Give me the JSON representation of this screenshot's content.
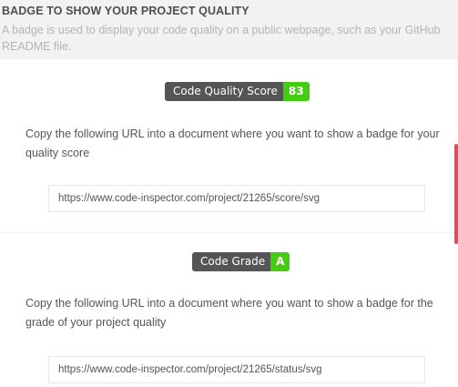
{
  "section": {
    "title": "BADGE TO SHOW YOUR PROJECT QUALITY",
    "description": "A badge is used to display your code quality on a public webpage, such as your GitHub README file."
  },
  "quality_badge": {
    "label": "Code Quality Score",
    "value": "83",
    "label_color": "#555555",
    "value_color": "#44cc11",
    "instruction": "Copy the following URL into a document where you want to show a badge for your quality score",
    "url": "https://www.code-inspector.com/project/21265/score/svg"
  },
  "grade_badge": {
    "label": "Code Grade",
    "value": "A",
    "label_color": "#555555",
    "value_color": "#44cc11",
    "instruction": "Copy the following URL into a document where you want to show a badge for the grade of your project quality",
    "url": "https://www.code-inspector.com/project/21265/status/svg"
  },
  "colors": {
    "accent": "#e8485c",
    "background": "#f2f2f2"
  }
}
